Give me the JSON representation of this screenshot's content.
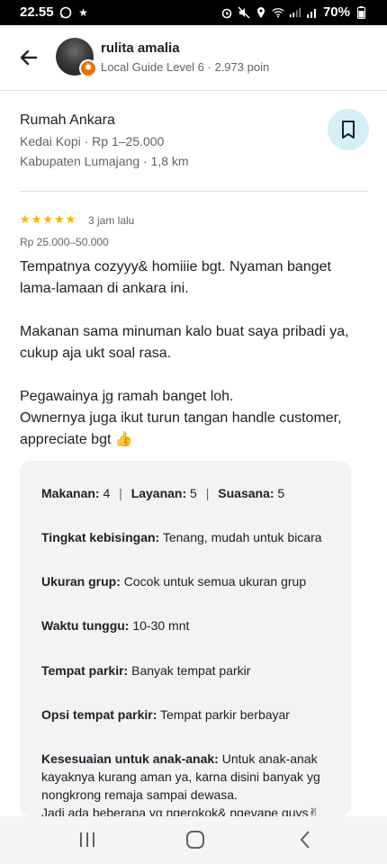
{
  "status_bar": {
    "time": "22.55",
    "battery": "70%"
  },
  "header": {
    "user_name": "rulita amalia",
    "user_meta": "Local Guide Level 6 · 2.973 poin"
  },
  "place": {
    "name": "Rumah Ankara",
    "category_price": "Kedai Kopi · Rp 1–25.000",
    "location": "Kabupaten Lumajang · 1,8 km"
  },
  "review": {
    "rating": 5,
    "stars": "★★★★★",
    "time": "3 jam lalu",
    "price_range": "Rp 25.000–50.000",
    "text": "Tempatnya cozyyy& homiiie bgt. Nyaman banget lama-lamaan di ankara ini.\n\nMakanan sama minuman kalo buat saya pribadi ya, cukup aja ukt soal rasa.\n\nPegawainya jg ramah banget loh.\nOwnernya juga ikut turun tangan handle customer, appreciate bgt 👍"
  },
  "attributes": {
    "food_label": "Makanan:",
    "food_value": "4",
    "service_label": "Layanan:",
    "service_value": "5",
    "atmosphere_label": "Suasana:",
    "atmosphere_value": "5",
    "separator": "|",
    "noise_label": "Tingkat kebisingan:",
    "noise_value": "Tenang, mudah untuk bicara",
    "group_label": "Ukuran grup:",
    "group_value": "Cocok untuk semua ukuran grup",
    "wait_label": "Waktu tunggu:",
    "wait_value": "10-30 mnt",
    "parking_label": "Tempat parkir:",
    "parking_value": "Banyak tempat parkir",
    "parking_opt_label": "Opsi tempat parkir:",
    "parking_opt_value": "Tempat parkir berbayar",
    "kids_label": "Kesesuaian untuk anak-anak:",
    "kids_value": "Untuk anak-anak kayaknya kurang aman ya, karna disini banyak yg nongkrong remaja sampai dewasa.",
    "kids_value_2": "Jadi ada beberapa yg ngerokok& ngevape guys✌"
  },
  "icons": {
    "back": "arrow-left",
    "save": "bookmark",
    "nav_recents": "recents",
    "nav_home": "home",
    "nav_back": "back"
  }
}
